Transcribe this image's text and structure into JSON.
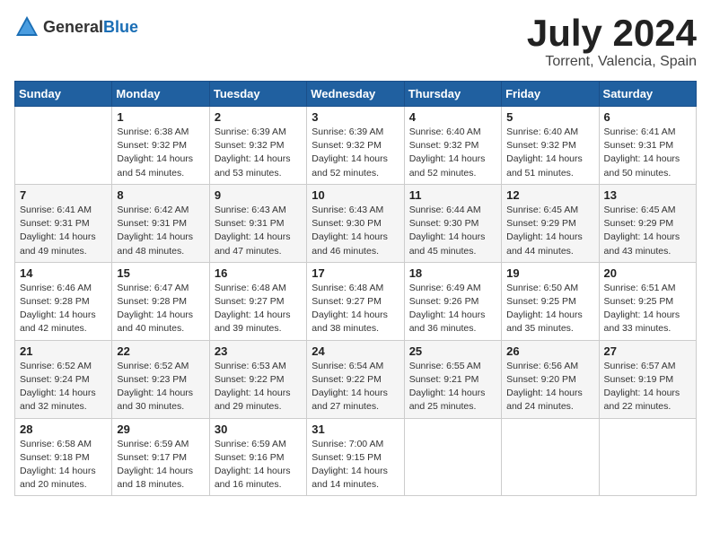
{
  "header": {
    "logo_general": "General",
    "logo_blue": "Blue",
    "month": "July 2024",
    "location": "Torrent, Valencia, Spain"
  },
  "days_of_week": [
    "Sunday",
    "Monday",
    "Tuesday",
    "Wednesday",
    "Thursday",
    "Friday",
    "Saturday"
  ],
  "weeks": [
    [
      {
        "day": "",
        "sunrise": "",
        "sunset": "",
        "daylight": ""
      },
      {
        "day": "1",
        "sunrise": "Sunrise: 6:38 AM",
        "sunset": "Sunset: 9:32 PM",
        "daylight": "Daylight: 14 hours and 54 minutes."
      },
      {
        "day": "2",
        "sunrise": "Sunrise: 6:39 AM",
        "sunset": "Sunset: 9:32 PM",
        "daylight": "Daylight: 14 hours and 53 minutes."
      },
      {
        "day": "3",
        "sunrise": "Sunrise: 6:39 AM",
        "sunset": "Sunset: 9:32 PM",
        "daylight": "Daylight: 14 hours and 52 minutes."
      },
      {
        "day": "4",
        "sunrise": "Sunrise: 6:40 AM",
        "sunset": "Sunset: 9:32 PM",
        "daylight": "Daylight: 14 hours and 52 minutes."
      },
      {
        "day": "5",
        "sunrise": "Sunrise: 6:40 AM",
        "sunset": "Sunset: 9:32 PM",
        "daylight": "Daylight: 14 hours and 51 minutes."
      },
      {
        "day": "6",
        "sunrise": "Sunrise: 6:41 AM",
        "sunset": "Sunset: 9:31 PM",
        "daylight": "Daylight: 14 hours and 50 minutes."
      }
    ],
    [
      {
        "day": "7",
        "sunrise": "Sunrise: 6:41 AM",
        "sunset": "Sunset: 9:31 PM",
        "daylight": "Daylight: 14 hours and 49 minutes."
      },
      {
        "day": "8",
        "sunrise": "Sunrise: 6:42 AM",
        "sunset": "Sunset: 9:31 PM",
        "daylight": "Daylight: 14 hours and 48 minutes."
      },
      {
        "day": "9",
        "sunrise": "Sunrise: 6:43 AM",
        "sunset": "Sunset: 9:31 PM",
        "daylight": "Daylight: 14 hours and 47 minutes."
      },
      {
        "day": "10",
        "sunrise": "Sunrise: 6:43 AM",
        "sunset": "Sunset: 9:30 PM",
        "daylight": "Daylight: 14 hours and 46 minutes."
      },
      {
        "day": "11",
        "sunrise": "Sunrise: 6:44 AM",
        "sunset": "Sunset: 9:30 PM",
        "daylight": "Daylight: 14 hours and 45 minutes."
      },
      {
        "day": "12",
        "sunrise": "Sunrise: 6:45 AM",
        "sunset": "Sunset: 9:29 PM",
        "daylight": "Daylight: 14 hours and 44 minutes."
      },
      {
        "day": "13",
        "sunrise": "Sunrise: 6:45 AM",
        "sunset": "Sunset: 9:29 PM",
        "daylight": "Daylight: 14 hours and 43 minutes."
      }
    ],
    [
      {
        "day": "14",
        "sunrise": "Sunrise: 6:46 AM",
        "sunset": "Sunset: 9:28 PM",
        "daylight": "Daylight: 14 hours and 42 minutes."
      },
      {
        "day": "15",
        "sunrise": "Sunrise: 6:47 AM",
        "sunset": "Sunset: 9:28 PM",
        "daylight": "Daylight: 14 hours and 40 minutes."
      },
      {
        "day": "16",
        "sunrise": "Sunrise: 6:48 AM",
        "sunset": "Sunset: 9:27 PM",
        "daylight": "Daylight: 14 hours and 39 minutes."
      },
      {
        "day": "17",
        "sunrise": "Sunrise: 6:48 AM",
        "sunset": "Sunset: 9:27 PM",
        "daylight": "Daylight: 14 hours and 38 minutes."
      },
      {
        "day": "18",
        "sunrise": "Sunrise: 6:49 AM",
        "sunset": "Sunset: 9:26 PM",
        "daylight": "Daylight: 14 hours and 36 minutes."
      },
      {
        "day": "19",
        "sunrise": "Sunrise: 6:50 AM",
        "sunset": "Sunset: 9:25 PM",
        "daylight": "Daylight: 14 hours and 35 minutes."
      },
      {
        "day": "20",
        "sunrise": "Sunrise: 6:51 AM",
        "sunset": "Sunset: 9:25 PM",
        "daylight": "Daylight: 14 hours and 33 minutes."
      }
    ],
    [
      {
        "day": "21",
        "sunrise": "Sunrise: 6:52 AM",
        "sunset": "Sunset: 9:24 PM",
        "daylight": "Daylight: 14 hours and 32 minutes."
      },
      {
        "day": "22",
        "sunrise": "Sunrise: 6:52 AM",
        "sunset": "Sunset: 9:23 PM",
        "daylight": "Daylight: 14 hours and 30 minutes."
      },
      {
        "day": "23",
        "sunrise": "Sunrise: 6:53 AM",
        "sunset": "Sunset: 9:22 PM",
        "daylight": "Daylight: 14 hours and 29 minutes."
      },
      {
        "day": "24",
        "sunrise": "Sunrise: 6:54 AM",
        "sunset": "Sunset: 9:22 PM",
        "daylight": "Daylight: 14 hours and 27 minutes."
      },
      {
        "day": "25",
        "sunrise": "Sunrise: 6:55 AM",
        "sunset": "Sunset: 9:21 PM",
        "daylight": "Daylight: 14 hours and 25 minutes."
      },
      {
        "day": "26",
        "sunrise": "Sunrise: 6:56 AM",
        "sunset": "Sunset: 9:20 PM",
        "daylight": "Daylight: 14 hours and 24 minutes."
      },
      {
        "day": "27",
        "sunrise": "Sunrise: 6:57 AM",
        "sunset": "Sunset: 9:19 PM",
        "daylight": "Daylight: 14 hours and 22 minutes."
      }
    ],
    [
      {
        "day": "28",
        "sunrise": "Sunrise: 6:58 AM",
        "sunset": "Sunset: 9:18 PM",
        "daylight": "Daylight: 14 hours and 20 minutes."
      },
      {
        "day": "29",
        "sunrise": "Sunrise: 6:59 AM",
        "sunset": "Sunset: 9:17 PM",
        "daylight": "Daylight: 14 hours and 18 minutes."
      },
      {
        "day": "30",
        "sunrise": "Sunrise: 6:59 AM",
        "sunset": "Sunset: 9:16 PM",
        "daylight": "Daylight: 14 hours and 16 minutes."
      },
      {
        "day": "31",
        "sunrise": "Sunrise: 7:00 AM",
        "sunset": "Sunset: 9:15 PM",
        "daylight": "Daylight: 14 hours and 14 minutes."
      },
      {
        "day": "",
        "sunrise": "",
        "sunset": "",
        "daylight": ""
      },
      {
        "day": "",
        "sunrise": "",
        "sunset": "",
        "daylight": ""
      },
      {
        "day": "",
        "sunrise": "",
        "sunset": "",
        "daylight": ""
      }
    ]
  ]
}
